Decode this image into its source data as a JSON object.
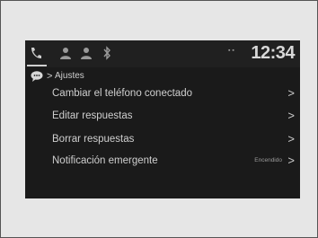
{
  "status_bar": {
    "icons": [
      "phone-icon",
      "contacts-icon",
      "voice-icon",
      "bluetooth-icon"
    ],
    "signal_label": "▪ ▪",
    "clock": "12:34"
  },
  "breadcrumb": {
    "icon": "speech-bubble-icon",
    "separator": ">",
    "label": "Ajustes"
  },
  "menu": {
    "items": [
      {
        "label": "Cambiar el teléfono conectado",
        "chevron": ">"
      },
      {
        "label": "Editar respuestas",
        "chevron": ">"
      },
      {
        "label": "Borrar respuestas",
        "chevron": ">"
      },
      {
        "label": "Notificación emergente",
        "status": "Encendido",
        "chevron": ">"
      }
    ]
  },
  "colors": {
    "screen_bg": "#1a1a1a",
    "text": "#cfcfcf",
    "frame_bg": "#e6e6e6"
  }
}
